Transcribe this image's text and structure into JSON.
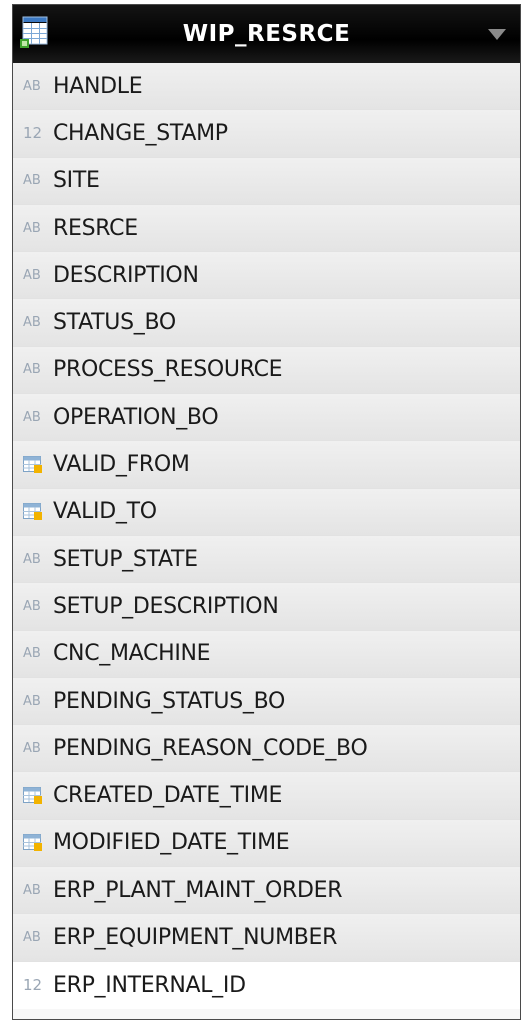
{
  "table": {
    "title": "WIP_RESRCE",
    "columns": [
      {
        "type": "text",
        "type_label": "AB",
        "name": "HANDLE"
      },
      {
        "type": "number",
        "type_label": "12",
        "name": "CHANGE_STAMP"
      },
      {
        "type": "text",
        "type_label": "AB",
        "name": "SITE"
      },
      {
        "type": "text",
        "type_label": "AB",
        "name": "RESRCE"
      },
      {
        "type": "text",
        "type_label": "AB",
        "name": "DESCRIPTION"
      },
      {
        "type": "text",
        "type_label": "AB",
        "name": "STATUS_BO"
      },
      {
        "type": "text",
        "type_label": "AB",
        "name": "PROCESS_RESOURCE"
      },
      {
        "type": "text",
        "type_label": "AB",
        "name": "OPERATION_BO"
      },
      {
        "type": "date",
        "type_label": "",
        "name": "VALID_FROM"
      },
      {
        "type": "date",
        "type_label": "",
        "name": "VALID_TO"
      },
      {
        "type": "text",
        "type_label": "AB",
        "name": "SETUP_STATE"
      },
      {
        "type": "text",
        "type_label": "AB",
        "name": "SETUP_DESCRIPTION"
      },
      {
        "type": "text",
        "type_label": "AB",
        "name": "CNC_MACHINE"
      },
      {
        "type": "text",
        "type_label": "AB",
        "name": "PENDING_STATUS_BO"
      },
      {
        "type": "text",
        "type_label": "AB",
        "name": "PENDING_REASON_CODE_BO"
      },
      {
        "type": "date",
        "type_label": "",
        "name": "CREATED_DATE_TIME"
      },
      {
        "type": "date",
        "type_label": "",
        "name": "MODIFIED_DATE_TIME"
      },
      {
        "type": "text",
        "type_label": "AB",
        "name": "ERP_PLANT_MAINT_ORDER"
      },
      {
        "type": "text",
        "type_label": "AB",
        "name": "ERP_EQUIPMENT_NUMBER"
      },
      {
        "type": "number",
        "type_label": "12",
        "name": "ERP_INTERNAL_ID"
      }
    ]
  },
  "icons": {
    "header": "table-grid-icon",
    "dropdown": "chevron-down-icon",
    "text": "text-type-icon",
    "number": "number-type-icon",
    "date": "date-type-icon"
  },
  "colors": {
    "header_bg": "#000000",
    "header_text": "#ffffff",
    "row_bg": "#e9e9e9",
    "type_icon": "#9aa6b4",
    "date_icon_accent": "#f2b300"
  }
}
